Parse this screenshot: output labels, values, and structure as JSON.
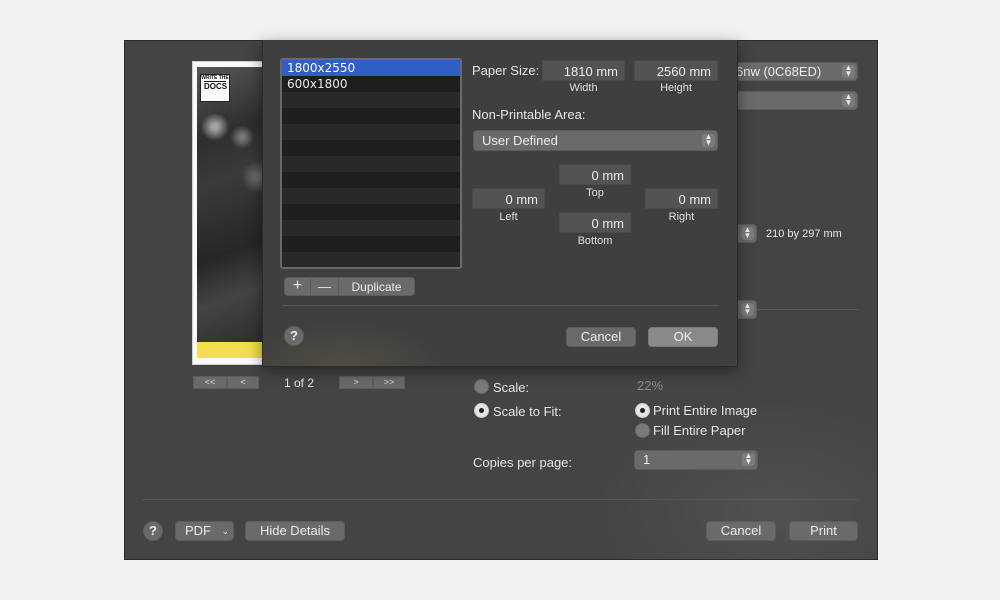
{
  "print_dialog": {
    "printer_value_partial": "6nw (0C68ED)",
    "presets_value": "",
    "paper_size_summary": "210 by 297 mm",
    "pagination": {
      "first": "<<",
      "prev": "<",
      "page_text": "1 of 2",
      "next": ">",
      "last": ">>"
    },
    "preview": {
      "logo_top": "WRITE THE",
      "logo_bottom": "DOCS"
    },
    "scale_label": "Scale:",
    "scale_value": "22%",
    "scale_to_fit_label": "Scale to Fit:",
    "print_entire_image_label": "Print Entire Image",
    "fill_entire_paper_label": "Fill Entire Paper",
    "copies_per_page_label": "Copies per page:",
    "copies_per_page_value": "1",
    "help_label": "?",
    "pdf_label": "PDF",
    "hide_details_label": "Hide Details",
    "cancel_label": "Cancel",
    "print_label": "Print"
  },
  "custom_paper": {
    "paper_sizes": [
      "1800x2550",
      "600x1800"
    ],
    "selected_paper": "1800x2550",
    "add_label": "+",
    "remove_label": "—",
    "duplicate_label": "Duplicate",
    "paper_size_label": "Paper Size:",
    "width_value": "1810 mm",
    "width_caption": "Width",
    "height_value": "2560 mm",
    "height_caption": "Height",
    "non_printable_label": "Non-Printable Area:",
    "non_printable_value": "User Defined",
    "top_value": "0 mm",
    "top_caption": "Top",
    "left_value": "0 mm",
    "left_caption": "Left",
    "right_value": "0 mm",
    "right_caption": "Right",
    "bottom_value": "0 mm",
    "bottom_caption": "Bottom",
    "help_label": "?",
    "cancel_label": "Cancel",
    "ok_label": "OK"
  }
}
